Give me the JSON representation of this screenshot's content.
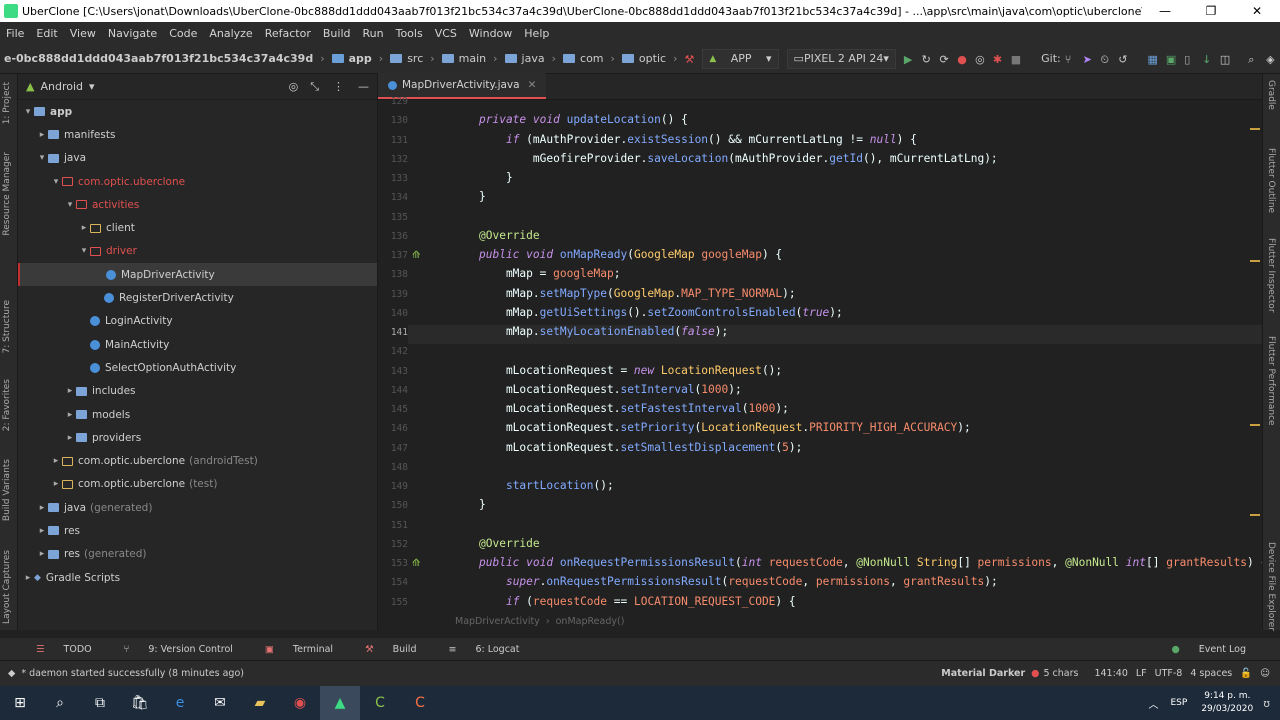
{
  "window": {
    "title": "UberClone [C:\\Users\\jonat\\Downloads\\UberClone-0bc888dd1ddd043aab7f013f21bc534c37a4c39d\\UberClone-0bc888dd1ddd043aab7f013f21bc534c37a4c39d] - ...\\app\\src\\main\\java\\com\\optic\\uberclone\\activities\\driver\\MapDriverActivity.java [app] - And..."
  },
  "menu": [
    "File",
    "Edit",
    "View",
    "Navigate",
    "Code",
    "Analyze",
    "Refactor",
    "Build",
    "Run",
    "Tools",
    "VCS",
    "Window",
    "Help"
  ],
  "navbar": {
    "project": "e-0bc888dd1ddd043aab7f013f21bc534c37a4c39d",
    "crumbs": [
      "app",
      "src",
      "main",
      "java",
      "com",
      "optic"
    ],
    "config": "APP",
    "device": "PIXEL 2 API 24",
    "git": "Git:"
  },
  "project_panel": {
    "view": "Android",
    "tree": [
      {
        "label": "app",
        "level": 0,
        "arrow": "▾",
        "type": "folder-fill",
        "bold": true
      },
      {
        "label": "manifests",
        "level": 1,
        "arrow": "▸",
        "type": "folder-fill"
      },
      {
        "label": "java",
        "level": 1,
        "arrow": "▾",
        "type": "folder-fill"
      },
      {
        "label": "com.optic.uberclone",
        "level": 2,
        "arrow": "▾",
        "type": "pkg",
        "red": true
      },
      {
        "label": "activities",
        "level": 3,
        "arrow": "▾",
        "type": "pkg",
        "red": true
      },
      {
        "label": "client",
        "level": 4,
        "arrow": "▸",
        "type": "src"
      },
      {
        "label": "driver",
        "level": 4,
        "arrow": "▾",
        "type": "pkg",
        "red": true
      },
      {
        "label": "MapDriverActivity",
        "level": 5,
        "arrow": "",
        "type": "class",
        "selected": true
      },
      {
        "label": "RegisterDriverActivity",
        "level": 5,
        "arrow": "",
        "type": "class"
      },
      {
        "label": "LoginActivity",
        "level": 4,
        "arrow": "",
        "type": "class"
      },
      {
        "label": "MainActivity",
        "level": 4,
        "arrow": "",
        "type": "class"
      },
      {
        "label": "SelectOptionAuthActivity",
        "level": 4,
        "arrow": "",
        "type": "class"
      },
      {
        "label": "includes",
        "level": 3,
        "arrow": "▸",
        "type": "folder-fill"
      },
      {
        "label": "models",
        "level": 3,
        "arrow": "▸",
        "type": "folder-fill"
      },
      {
        "label": "providers",
        "level": 3,
        "arrow": "▸",
        "type": "folder-fill"
      },
      {
        "label": "com.optic.uberclone",
        "suffix": "(androidTest)",
        "level": 2,
        "arrow": "▸",
        "type": "src"
      },
      {
        "label": "com.optic.uberclone",
        "suffix": "(test)",
        "level": 2,
        "arrow": "▸",
        "type": "src"
      },
      {
        "label": "java",
        "suffix": "(generated)",
        "level": 1,
        "arrow": "▸",
        "type": "folder-fill"
      },
      {
        "label": "res",
        "level": 1,
        "arrow": "▸",
        "type": "folder-fill"
      },
      {
        "label": "res",
        "suffix": "(generated)",
        "level": 1,
        "arrow": "▸",
        "type": "folder-fill"
      },
      {
        "label": "Gradle Scripts",
        "level": 0,
        "arrow": "▸",
        "type": "gradle"
      }
    ]
  },
  "left_tools": [
    "1: Project",
    "Resource Manager",
    "7: Structure",
    "2: Favorites",
    "Build Variants",
    "Layout Captures"
  ],
  "right_tools": [
    "Gradle",
    "Flutter Outline",
    "Flutter Inspector",
    "Flutter Performance",
    "Device File Explorer"
  ],
  "editor": {
    "tab": "MapDriverActivity.java",
    "breadcrumb": [
      "MapDriverActivity",
      "onMapReady()"
    ],
    "lines": [
      {
        "n": "129",
        "html": ""
      },
      {
        "n": "130",
        "html": "<span class='kw'>private void</span> <span class='fn'>updateLocation</span>() {"
      },
      {
        "n": "131",
        "html": "    <span class='kw'>if</span> (mAuthProvider.<span class='fn'>existSession</span>() &amp;&amp; mCurrentLatLng != <span class='kw'>null</span>) {"
      },
      {
        "n": "132",
        "html": "        mGeofireProvider.<span class='fn'>saveLocation</span>(mAuthProvider.<span class='fn'>getId</span>(), mCurrentLatLng);"
      },
      {
        "n": "133",
        "html": "    }"
      },
      {
        "n": "134",
        "html": "}"
      },
      {
        "n": "135",
        "html": ""
      },
      {
        "n": "136",
        "html": "<span class='an'>@Override</span>"
      },
      {
        "n": "137",
        "html": "<span class='kw'>public void</span> <span class='fn'>onMapReady</span>(<span class='ty'>GoogleMap</span> <span class='cn'>googleMap</span>) {"
      },
      {
        "n": "138",
        "html": "    mMap = <span class='cn'>googleMap</span>;"
      },
      {
        "n": "139",
        "html": "    mMap.<span class='fn'>setMapType</span>(<span class='ty'>GoogleMap</span>.<span class='cn'>MAP_TYPE_NORMAL</span>);"
      },
      {
        "n": "140",
        "html": "    mMap.<span class='fn'>getUiSettings</span>().<span class='fn'>setZoomControlsEnabled</span>(<span class='kw'>true</span>);"
      },
      {
        "n": "141",
        "html": "    mMap.<span class='fn'>setMyLocationEnabled</span>(<span class='kw'>false</span>);"
      },
      {
        "n": "142",
        "html": ""
      },
      {
        "n": "143",
        "html": "    mLocationRequest = <span class='kw'>new</span> <span class='ty'>LocationRequest</span>();"
      },
      {
        "n": "144",
        "html": "    mLocationRequest.<span class='fn'>setInterval</span>(<span class='nm'>1000</span>);"
      },
      {
        "n": "145",
        "html": "    mLocationRequest.<span class='fn'>setFastestInterval</span>(<span class='nm'>1000</span>);"
      },
      {
        "n": "146",
        "html": "    mLocationRequest.<span class='fn'>setPriority</span>(<span class='ty'>LocationRequest</span>.<span class='cn'>PRIORITY_HIGH_ACCURACY</span>);"
      },
      {
        "n": "147",
        "html": "    mLocationRequest.<span class='fn'>setSmallestDisplacement</span>(<span class='nm'>5</span>);"
      },
      {
        "n": "148",
        "html": ""
      },
      {
        "n": "149",
        "html": "    <span class='fn'>startLocation</span>();"
      },
      {
        "n": "150",
        "html": "}"
      },
      {
        "n": "151",
        "html": ""
      },
      {
        "n": "152",
        "html": "<span class='an'>@Override</span>"
      },
      {
        "n": "153",
        "html": "<span class='kw'>public void</span> <span class='fn'>onRequestPermissionsResult</span>(<span class='kw'>int</span> <span class='cn'>requestCode</span>, <span class='an'>@NonNull</span> <span class='ty'>String</span>[] <span class='cn'>permissions</span>, <span class='an'>@NonNull</span> <span class='kw'>int</span>[] <span class='cn'>grantResults</span>) {"
      },
      {
        "n": "154",
        "html": "    <span class='kw'>super</span>.<span class='fn'>onRequestPermissionsResult</span>(<span class='cn'>requestCode</span>, <span class='cn'>permissions</span>, <span class='cn'>grantResults</span>);"
      },
      {
        "n": "155",
        "html": "    <span class='kw'>if</span> (<span class='cn'>requestCode</span> == <span class='cn'>LOCATION_REQUEST_CODE</span>) {"
      }
    ],
    "current_line": "141"
  },
  "tool_windows": [
    "TODO",
    "9: Version Control",
    "Terminal",
    "Build",
    "6: Logcat"
  ],
  "event_log": "Event Log",
  "status": {
    "message": "* daemon started successfully (8 minutes ago)",
    "theme": "Material Darker",
    "chars": "5 chars",
    "position": "141:40",
    "line_sep": "LF",
    "encoding": "UTF-8",
    "indent": "4 spaces"
  },
  "taskbar": {
    "lang": "ESP",
    "time": "9:14 p. m.",
    "date": "29/03/2020"
  }
}
